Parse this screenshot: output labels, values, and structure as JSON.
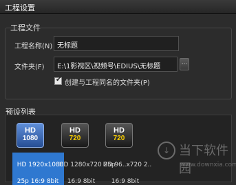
{
  "window": {
    "title": "工程设置"
  },
  "project": {
    "group_title": "工程文件",
    "name_label": "工程名称(N)",
    "name_value": "无标题",
    "folder_label": "文件夹(F)",
    "folder_value": "E:\\1影视区\\视频号\\EDIUS\\无标题",
    "browse_label": "...",
    "create_folder_label": "创建与工程同名的文件夹(P)",
    "create_folder_checked": true
  },
  "presets": {
    "title": "预设列表",
    "items": [
      {
        "icon_top": "HD",
        "icon_bottom": "1080",
        "label_line1": "HD 1920x1080",
        "label_line2": "25p 16:9 8bit",
        "selected": true
      },
      {
        "icon_top": "HD",
        "icon_bottom": "720",
        "label_line1": "HD 1280x720 25p",
        "label_line2": "16:9 8bit",
        "selected": false
      },
      {
        "icon_top": "HD",
        "icon_bottom": "720",
        "label_line1": "HD 96..x720 2..",
        "label_line2": "16:9 8bit",
        "selected": false
      }
    ]
  },
  "watermark": {
    "text": "当下软件园",
    "url": "www.downxia.com"
  }
}
